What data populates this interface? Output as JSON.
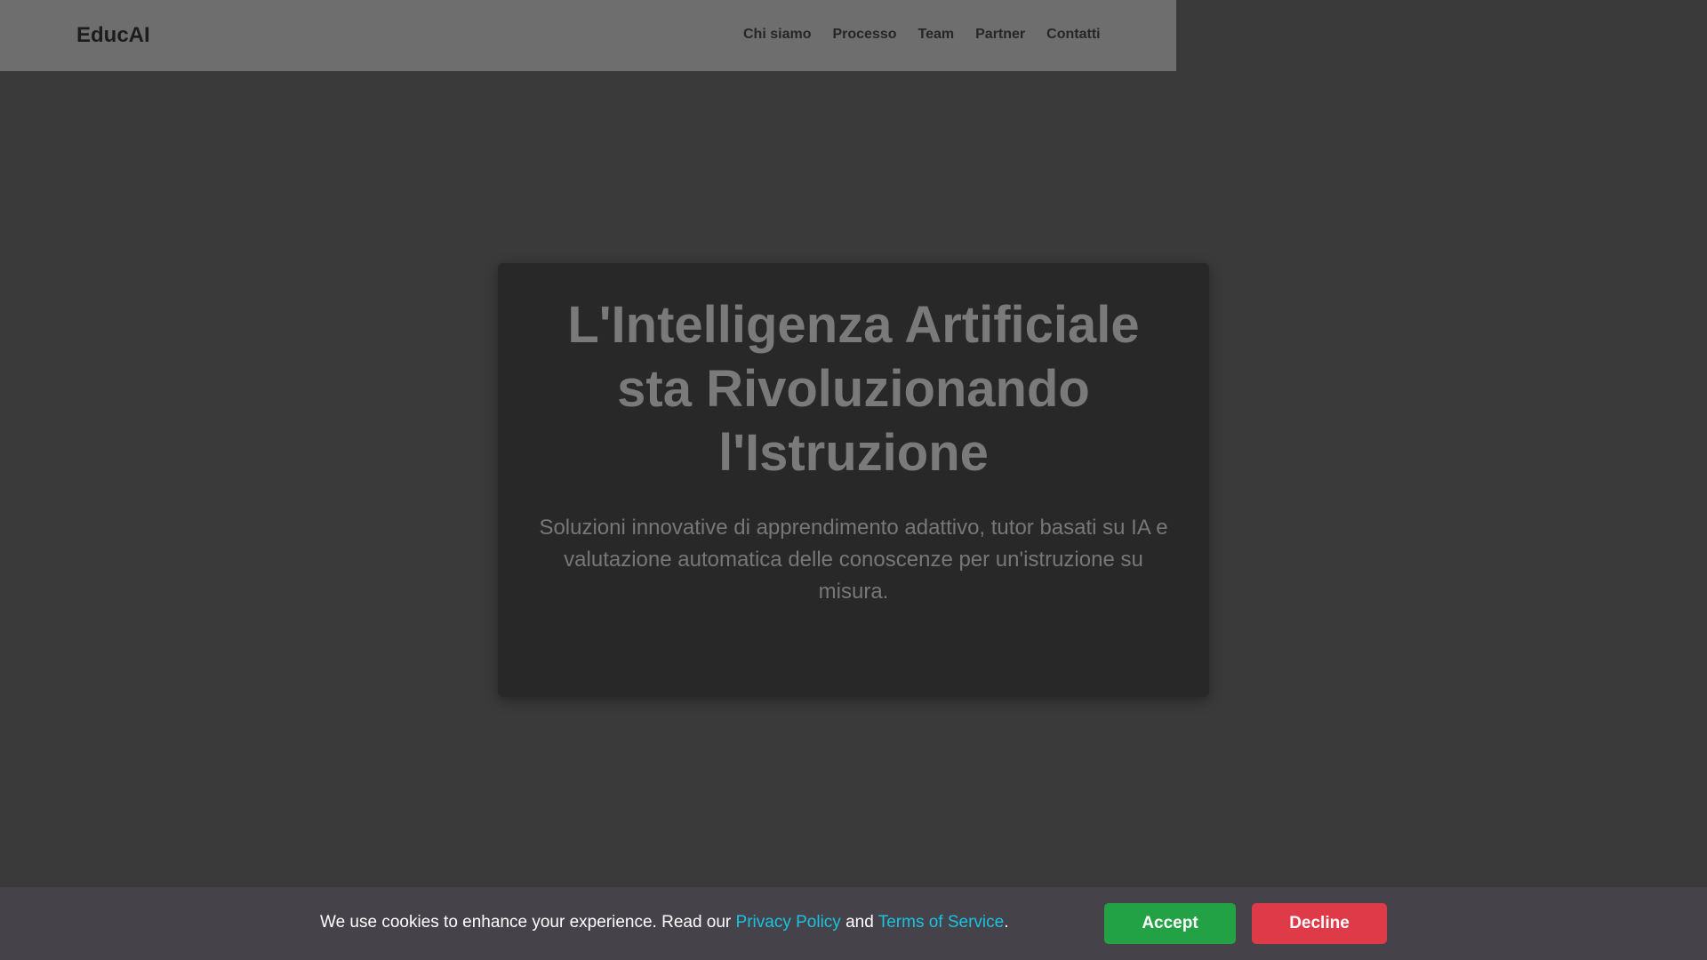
{
  "header": {
    "logo": "EducAI",
    "nav": [
      {
        "label": "Chi siamo"
      },
      {
        "label": "Processo"
      },
      {
        "label": "Team"
      },
      {
        "label": "Partner"
      },
      {
        "label": "Contatti"
      }
    ]
  },
  "hero": {
    "title_lines": [
      "L'Intelligenza Artificiale",
      "sta Rivoluzionando",
      "l'Istruzione"
    ],
    "subtitle": "Soluzioni innovative di apprendimento adattivo, tutor basati su IA e valutazione automatica delle conoscenze per un'istruzione su misura."
  },
  "cookie_banner": {
    "text_before": "We use cookies to enhance your experience. Read our ",
    "privacy_link": "Privacy Policy",
    "text_and": " and ",
    "terms_link": "Terms of Service",
    "text_after": ".",
    "accept_label": "Accept",
    "decline_label": "Decline"
  },
  "colors": {
    "page_background": "#3a3a3a",
    "header_background": "#6e6e6e",
    "hero_background": "#282828",
    "cookie_background": "#46424a",
    "link": "#17c3e0",
    "accept": "#22a244",
    "decline": "#df3a48"
  }
}
